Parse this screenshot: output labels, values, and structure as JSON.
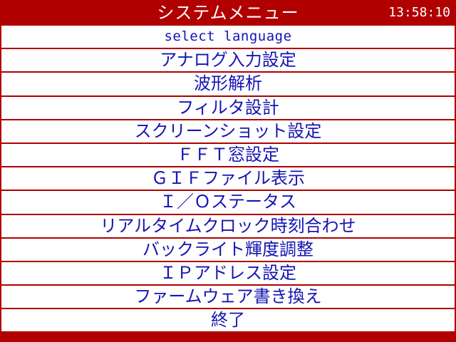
{
  "window": {
    "title": "システムメニュー",
    "clock": "13:58:10"
  },
  "menu": {
    "items": [
      {
        "label": "select language"
      },
      {
        "label": "アナログ入力設定"
      },
      {
        "label": "波形解析"
      },
      {
        "label": "フィルタ設計"
      },
      {
        "label": "スクリーンショット設定"
      },
      {
        "label": "ＦＦＴ窓設定"
      },
      {
        "label": "ＧＩＦファイル表示"
      },
      {
        "label": "Ｉ／Ｏステータス"
      },
      {
        "label": "リアルタイムクロック時刻合わせ"
      },
      {
        "label": "バックライト輝度調整"
      },
      {
        "label": "ＩＰアドレス設定"
      },
      {
        "label": "ファームウェア書き換え"
      },
      {
        "label": "終了"
      }
    ]
  },
  "colors": {
    "accent": "#b00000",
    "text": "#1414b4",
    "background": "#ffffff"
  }
}
